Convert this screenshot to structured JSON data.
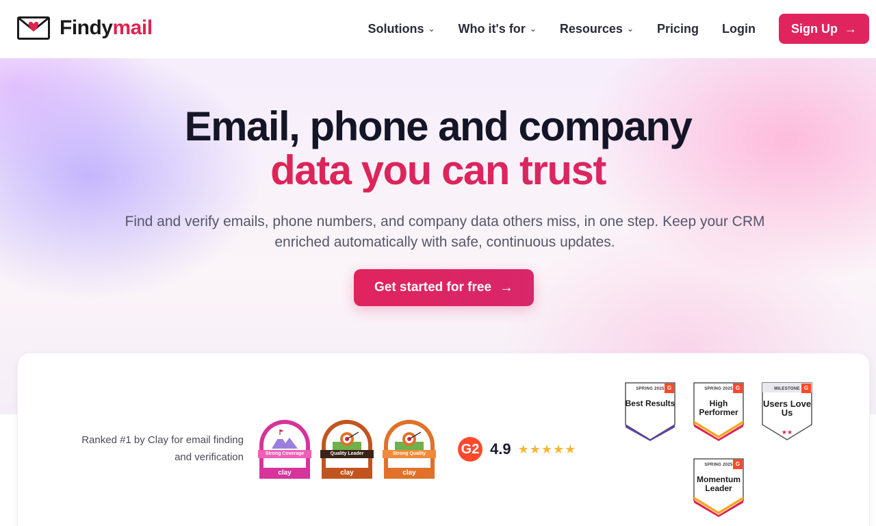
{
  "brand": {
    "name_part1": "Findy",
    "name_part2": "mail",
    "accent": "#e0234e"
  },
  "nav": {
    "items": [
      {
        "label": "Solutions",
        "has_dropdown": true
      },
      {
        "label": "Who it's for",
        "has_dropdown": true
      },
      {
        "label": "Resources",
        "has_dropdown": true
      },
      {
        "label": "Pricing",
        "has_dropdown": false
      },
      {
        "label": "Login",
        "has_dropdown": false
      }
    ],
    "signup_label": "Sign Up"
  },
  "hero": {
    "title_line1": "Email, phone and company",
    "title_line2": "data you can trust",
    "subtitle": "Find and verify emails, phone numbers, and company data others miss, in one step. Keep your CRM enriched automatically with safe, continuous updates.",
    "cta_label": "Get started for free"
  },
  "proof": {
    "ranked_text": "Ranked #1 by Clay for email finding and verification",
    "clay_badges": [
      {
        "label": "Strong Coverage",
        "brand": "clay",
        "color": "#d6339b"
      },
      {
        "label": "Quality Leader",
        "brand": "clay",
        "color": "#c2551f"
      },
      {
        "label": "Strong Quality",
        "brand": "clay",
        "color": "#e0712a"
      }
    ],
    "g2": {
      "logo": "G2",
      "rating": "4.9",
      "stars": "★★★★★"
    },
    "g2_badges": [
      {
        "season": "SPRING 2025",
        "name": "Best Results"
      },
      {
        "season": "SPRING 2025",
        "name": "High Performer"
      },
      {
        "season": "MILESTONE",
        "name": "Users Love Us"
      },
      {
        "season": "SPRING 2025",
        "name": "Momentum Leader"
      }
    ]
  }
}
